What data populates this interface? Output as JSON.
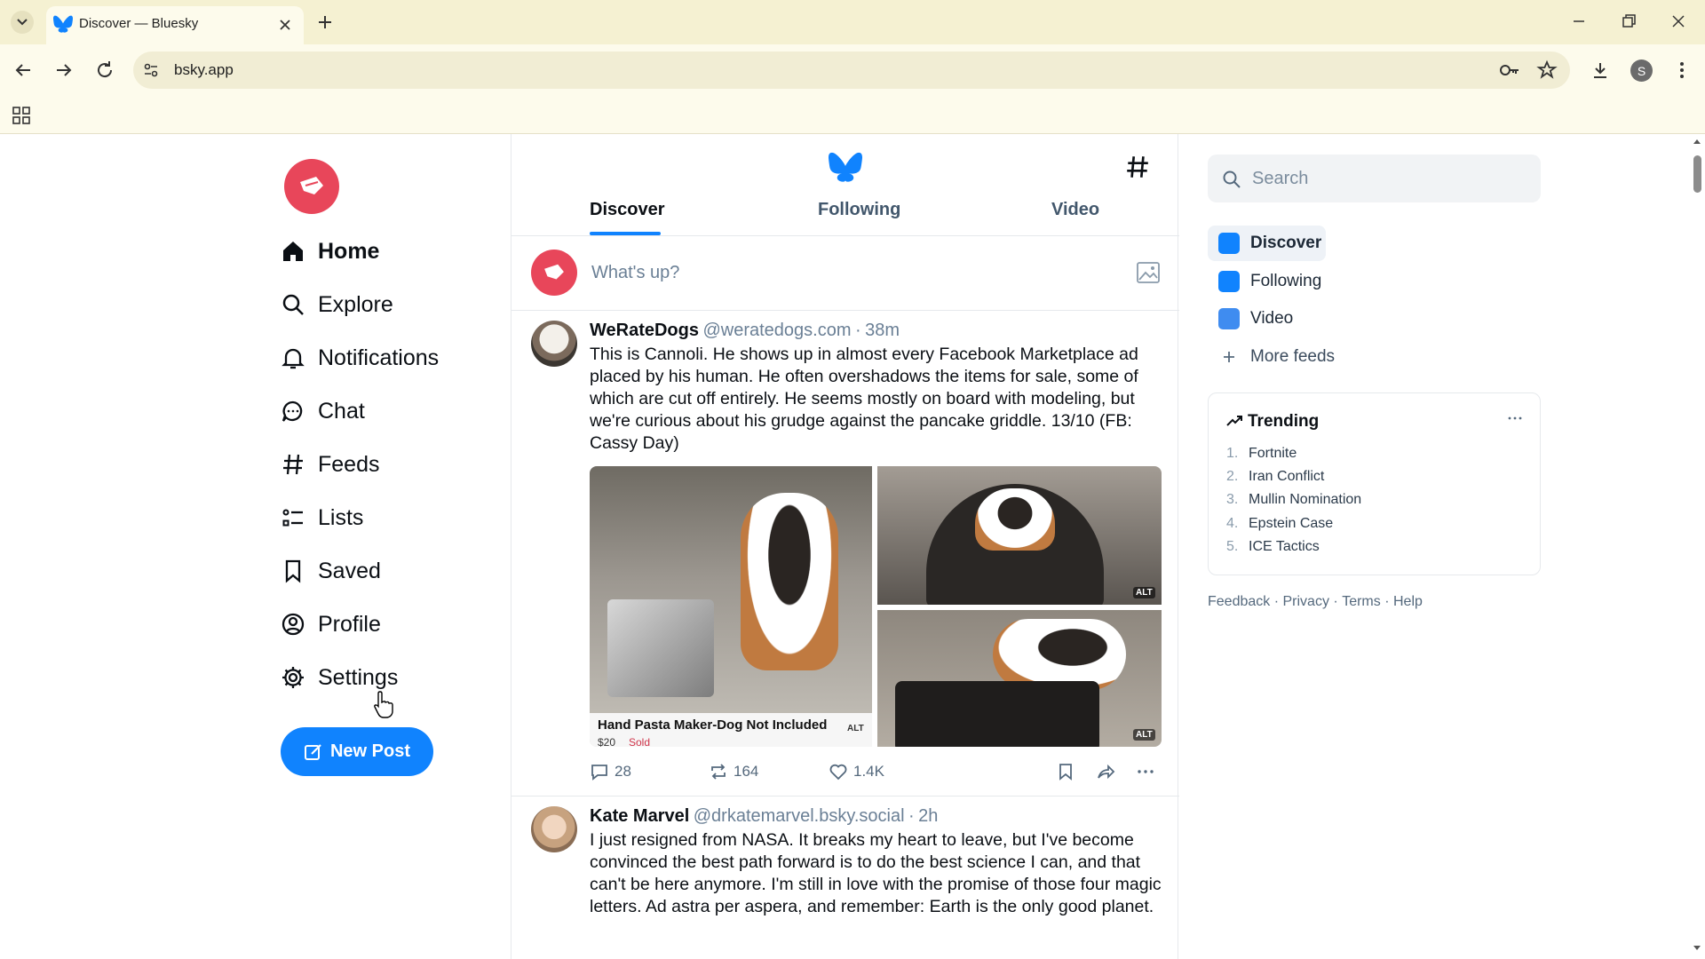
{
  "browser": {
    "tab_title": "Discover — Bluesky",
    "url": "bsky.app",
    "profile_initial": "S",
    "new_tab_label": "+"
  },
  "left_nav": {
    "items": [
      {
        "label": "Home",
        "icon": "home-icon",
        "active": true
      },
      {
        "label": "Explore",
        "icon": "search-icon"
      },
      {
        "label": "Notifications",
        "icon": "bell-icon"
      },
      {
        "label": "Chat",
        "icon": "chat-bubble-icon"
      },
      {
        "label": "Feeds",
        "icon": "hash-icon"
      },
      {
        "label": "Lists",
        "icon": "list-icon"
      },
      {
        "label": "Saved",
        "icon": "bookmark-icon"
      },
      {
        "label": "Profile",
        "icon": "profile-icon"
      },
      {
        "label": "Settings",
        "icon": "gear-icon"
      }
    ],
    "new_post_label": "New Post"
  },
  "feed": {
    "tabs": [
      "Discover",
      "Following",
      "Video"
    ],
    "active_tab": "Discover",
    "composer_placeholder": "What's up?",
    "posts": [
      {
        "name": "WeRateDogs",
        "handle": "@weratedogs.com",
        "time": "38m",
        "text": "This is Cannoli. He shows up in almost every Facebook Marketplace ad placed by his human. He often overshadows the items for sale, some of which are cut off entirely. He seems mostly on board with modeling, but we're curious about his grudge against the pancake griddle. 13/10 (FB: Cassy Day)",
        "image_caption": "Hand Pasta Maker-Dog Not Included",
        "image_price": "$20",
        "image_status": "Sold",
        "alt_badge": "ALT",
        "replies": "28",
        "reposts": "164",
        "likes": "1.4K"
      },
      {
        "name": "Kate Marvel",
        "handle": "@drkatemarvel.bsky.social",
        "time": "2h",
        "text": "I just resigned from NASA. It breaks my heart to leave, but I've become convinced the best path forward is to do the best science I can, and that can't be here anymore. I'm still in love with the promise of those four magic letters. Ad astra per aspera, and remember: Earth is the only good planet."
      }
    ]
  },
  "sidebar": {
    "search_placeholder": "Search",
    "feeds": [
      {
        "label": "Discover",
        "color": "#1083fe"
      },
      {
        "label": "Following",
        "color": "#1083fe"
      },
      {
        "label": "Video",
        "color": "#1083fe"
      }
    ],
    "more_feeds_label": "More feeds",
    "trending_title": "Trending",
    "trending": [
      "Fortnite",
      "Iran Conflict",
      "Mullin Nomination",
      "Epstein Case",
      "ICE Tactics"
    ],
    "footer_links": [
      "Feedback",
      "Privacy",
      "Terms",
      "Help"
    ]
  },
  "colors": {
    "accent": "#1083fe",
    "brand_red": "#e8465a"
  }
}
